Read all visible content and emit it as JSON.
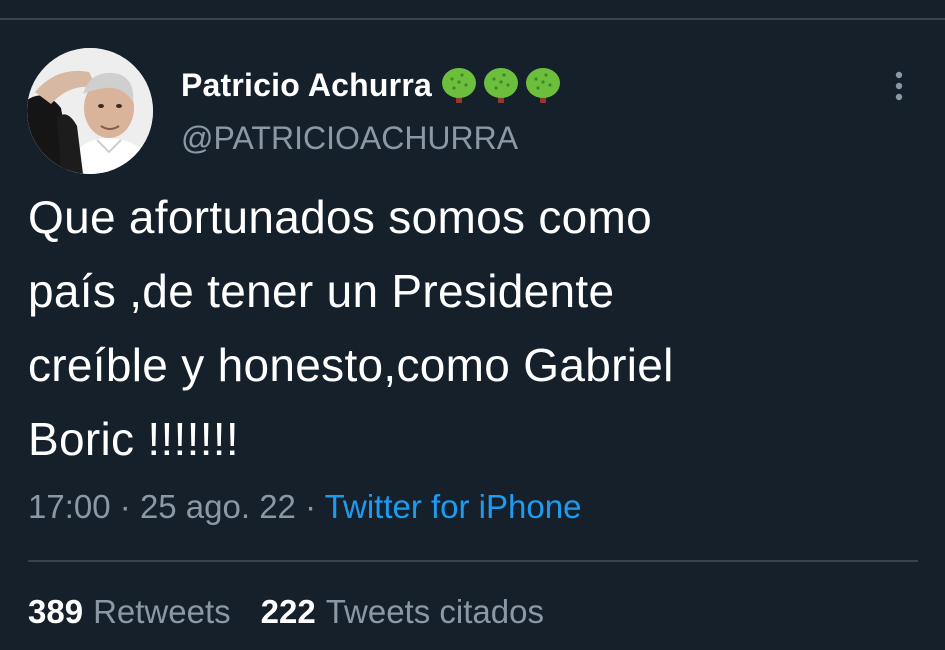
{
  "tweet": {
    "author": {
      "display_name": "Patricio Achurra",
      "handle": "@PATRICIOACHURRA",
      "name_emojis": [
        "tree-icon",
        "tree-icon",
        "tree-icon"
      ]
    },
    "text": "Que afortunados somos como\npaís ,de tener un Presidente\ncreíble y honesto,como Gabriel\nBoric !!!!!!!",
    "time": "17:00",
    "date": "25 ago. 22",
    "separator": "·",
    "source": "Twitter for iPhone",
    "stats": {
      "retweets_count": "389",
      "retweets_label": "Retweets",
      "quotes_count": "222",
      "quotes_label": "Tweets citados"
    }
  },
  "colors": {
    "background": "#15202b",
    "text_primary": "#ffffff",
    "text_secondary": "#8b98a5",
    "link": "#1d9bf0",
    "divider": "#38444d"
  }
}
